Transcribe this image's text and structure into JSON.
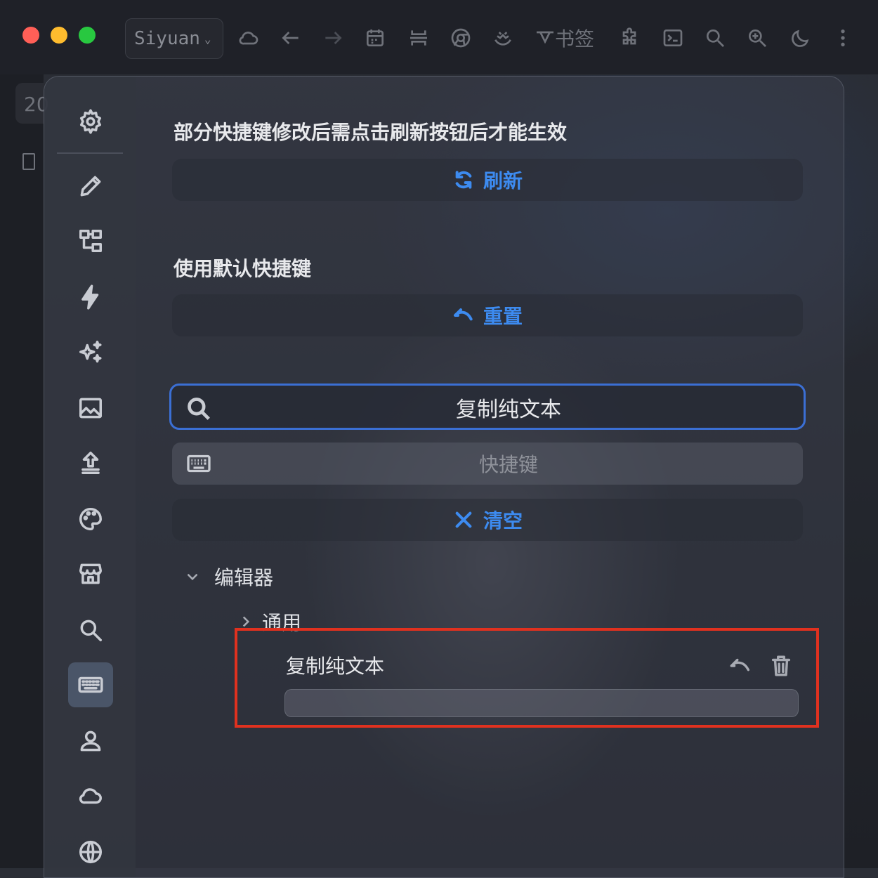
{
  "window": {
    "workspace": "Siyuan",
    "workspace_chevron": "⌄",
    "toolbar_text": "书签",
    "traffic_lights": {
      "close": "#ff5f57",
      "minimize": "#febc2e",
      "zoom": "#28c840"
    },
    "toolbar_icons": [
      "cloud-icon",
      "back-icon",
      "forward-icon",
      "calendar-icon",
      "split-icon",
      "browser-icon",
      "theme-icon",
      "bookmark-icon",
      "plugin-icon",
      "terminal-icon",
      "search-icon",
      "zoom-in-icon",
      "moon-icon",
      "more-icon"
    ]
  },
  "side_strip": {
    "badge": "20"
  },
  "settings": {
    "nav": [
      "gear-icon",
      "pencil-icon",
      "tree-icon",
      "flash-icon",
      "sparkle-icon",
      "image-icon",
      "upload-icon",
      "palette-icon",
      "store-icon",
      "search-icon",
      "keyboard-icon",
      "account-icon",
      "cloud-icon",
      "globe-icon"
    ],
    "active_nav": "keyboard-icon",
    "refresh_hint": "部分快捷键修改后需点击刷新按钮后才能生效",
    "refresh_label": "刷新",
    "reset_hint": "使用默认快捷键",
    "reset_label": "重置",
    "search_value": "复制纯文本",
    "shortcut_placeholder": "快捷键",
    "clear_label": "清空",
    "accent_color": "#3d8bf0",
    "tree": {
      "group": "编辑器",
      "subgroup": "通用",
      "item": {
        "label": "复制纯文本",
        "shortcut": ""
      }
    },
    "highlight_color": "#e0311f"
  }
}
